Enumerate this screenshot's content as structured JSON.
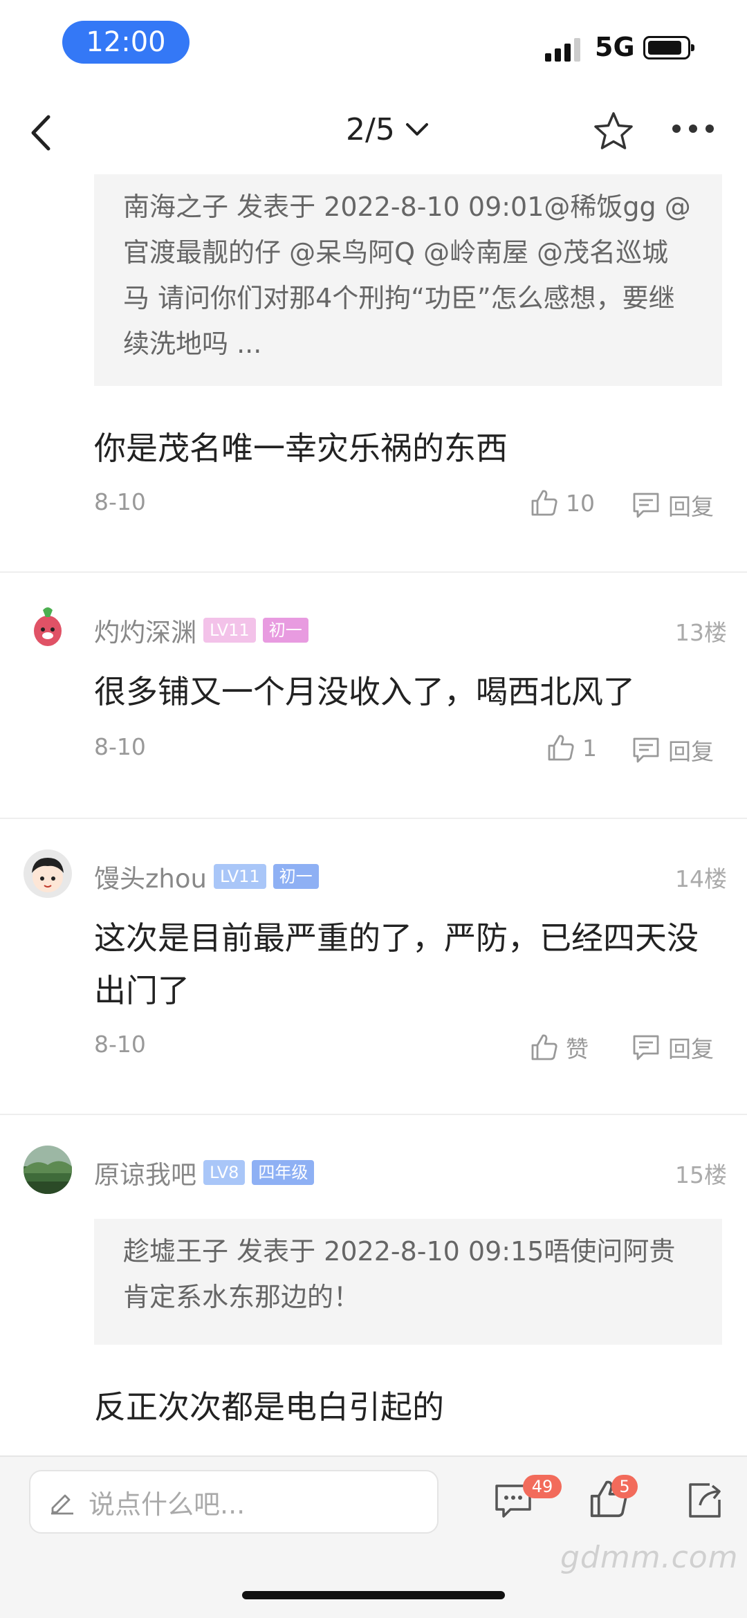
{
  "status_bar": {
    "time": "12:00",
    "network": "5G"
  },
  "nav": {
    "page_indicator": "2/5"
  },
  "comments": [
    {
      "quote": "南海之子 发表于 2022-8-10 09:01@稀饭gg @官渡最靓的仔 @呆鸟阿Q @岭南屋 @茂名巡城马 请问你们对那4个刑拘“功臣”怎么感想，要继续洗地吗 ...",
      "text": "你是茂名唯一幸灾乐祸的东西",
      "date": "8-10",
      "likes": "10",
      "reply_label": "回复"
    },
    {
      "username": "灼灼深渊",
      "level": "LV11",
      "rank": "初一",
      "floor": "13楼",
      "text": "很多铺又一个月没收入了，喝西北风了",
      "date": "8-10",
      "likes": "1",
      "reply_label": "回复"
    },
    {
      "username": "馒头zhou",
      "level": "LV11",
      "rank": "初一",
      "floor": "14楼",
      "text": "这次是目前最严重的了，严防，已经四天没出门了",
      "date": "8-10",
      "likes": "赞",
      "reply_label": "回复"
    },
    {
      "username": "原谅我吧",
      "level": "LV8",
      "rank": "四年级",
      "floor": "15楼",
      "quote": "趁墟王子 发表于 2022-8-10 09:15唔使问阿贵肯定系水东那边的！",
      "text": "反正次次都是电白引起的"
    }
  ],
  "bottom_bar": {
    "input_placeholder": "说点什么吧...",
    "comment_count": "49",
    "like_count": "5"
  },
  "watermark": "gdmm.com",
  "colors": {
    "accent": "#3478f6",
    "badge_red": "#f26b5b"
  }
}
